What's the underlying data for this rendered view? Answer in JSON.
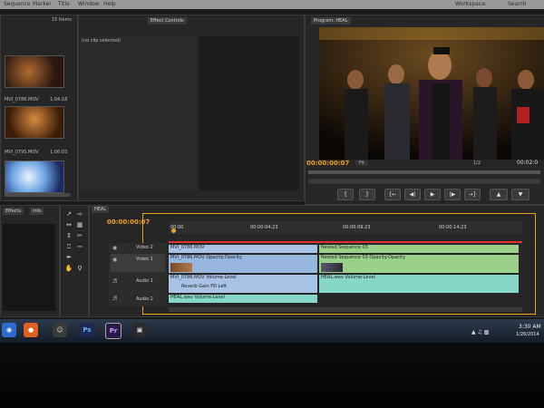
{
  "menubar": {
    "items": [
      "Sequence",
      "Marker",
      "Title",
      "Window",
      "Help"
    ],
    "workspace_label": "Workspace:",
    "search_label": "Search"
  },
  "project": {
    "count": "15 Items",
    "clips": [
      {
        "name": "MVI_0786.MOV",
        "duration": "1:04:18"
      },
      {
        "name": "MVI_0795.MOV",
        "duration": "1:06:03"
      }
    ]
  },
  "effect_controls": {
    "tab": "Effect Controls",
    "no_clip": "(no clip selected)"
  },
  "program": {
    "tab": "Program: HEAL",
    "timecode": "00:00:00:07",
    "fit": "Fit",
    "resolution": "1/2",
    "duration": "00:02:0"
  },
  "transport": [
    "{",
    "}",
    "{←",
    "◀|",
    "▶",
    "|▶",
    "→}"
  ],
  "effects_panel": {
    "tab": "Effects",
    "tab2": "Info"
  },
  "timeline": {
    "tab": "HEAL",
    "timecode": "00:00:00:07",
    "ruler": [
      "00:00",
      "00:00:04:23",
      "00:00:09:23",
      "00:00:14:23"
    ],
    "tracks": [
      {
        "label": "Video 2"
      },
      {
        "label": "Video 1"
      },
      {
        "label": "Audio 1"
      },
      {
        "label": "Audio 2"
      }
    ],
    "clips": {
      "v2_a": "MVI_0786.MOV",
      "v1_a": "MVI_0786.MOV  Opacity:Opacity",
      "v2_b": "Nested Sequence 03",
      "v1_b": "Nested Sequence 03  Opacity:Opacity",
      "a1_a": "MVI_0786.MOV  Volume:Level",
      "a1_b": "HEAL.wav  Volume:Level",
      "a2_a": "HEAL.wav  Volume:Level",
      "a1_fx": "Reverb  Gain  Fill Left"
    }
  },
  "taskbar": {
    "apps": [
      "Ps",
      "Pr"
    ],
    "time": "3:30 AM",
    "date": "1/26/2014"
  },
  "colors": {
    "accent_orange": "#f0a020",
    "playhead_red": "#e03030",
    "video_clip": "#a9c3e6",
    "nested_clip": "#9ad08a",
    "audio_clip": "#87d7c8"
  }
}
